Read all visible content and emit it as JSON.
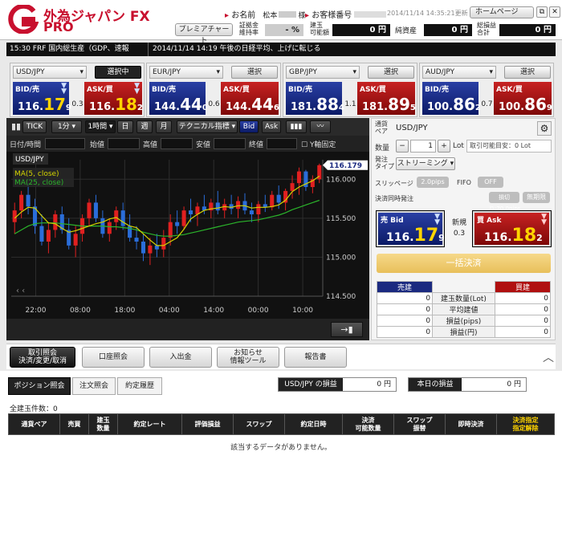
{
  "header": {
    "logo_main": "外為ジャパン",
    "logo_fx": "FX",
    "logo_sub": "PRO",
    "name_label": "お名前",
    "name_value": "松本",
    "name_suffix": "様",
    "customer_label": "お客様番号",
    "timestamp": "2014/11/14 14:35:21更新",
    "home_button": "ホームページ",
    "demo_button": "プレミアチャート",
    "margin_label": "証拠金\n維持率",
    "margin_value": "- %",
    "collateral_label": "建玉\n可能額",
    "collateral_value": "0 円",
    "net_asset_label": "純資産",
    "net_asset_value": "0 円",
    "total_pl_label": "総損益\n合計",
    "total_pl_value": "0 円"
  },
  "news": {
    "left": "15:30 FRF 国内総生産（GDP、速報",
    "right": "2014/11/14 14:19 午後の日経平均、上げに転じる"
  },
  "currency_panels": [
    {
      "pair": "USD/JPY",
      "button": "選択中",
      "bid_label": "BID/売",
      "ask_label": "ASK/買",
      "bid_prefix": "116.",
      "bid_big": "17",
      "bid_small": "9",
      "ask_prefix": "116.",
      "ask_big": "18",
      "ask_small": "2",
      "spread": "0.3"
    },
    {
      "pair": "EUR/JPY",
      "button": "選択",
      "bid_label": "BID/売",
      "ask_label": "ASK/買",
      "bid_prefix": "144.",
      "bid_big": "44",
      "bid_small": "0",
      "ask_prefix": "144.",
      "ask_big": "44",
      "ask_small": "6",
      "spread": "0.6"
    },
    {
      "pair": "GBP/JPY",
      "button": "選択",
      "bid_label": "BID/売",
      "ask_label": "ASK/買",
      "bid_prefix": "181.",
      "bid_big": "88",
      "bid_small": "4",
      "ask_prefix": "181.",
      "ask_big": "89",
      "ask_small": "5",
      "spread": "1.1"
    },
    {
      "pair": "AUD/JPY",
      "button": "選択",
      "bid_label": "BID/売",
      "ask_label": "ASK/買",
      "bid_prefix": "100.",
      "bid_big": "86",
      "bid_small": "2",
      "ask_prefix": "100.",
      "ask_big": "86",
      "ask_small": "9",
      "spread": "0.7"
    }
  ],
  "chart_toolbar": {
    "tick": "TICK",
    "period": "1分",
    "timeframe": "1時間",
    "day": "日",
    "week": "週",
    "month": "月",
    "technical": "テクニカル指標",
    "bid": "Bid",
    "ask": "Ask",
    "date_label": "日付/時間",
    "open_label": "始値",
    "high_label": "高値",
    "low_label": "安値",
    "close_label": "終値",
    "yfix_label": "Y軸固定"
  },
  "chart_data": {
    "type": "candlestick",
    "symbol": "USD/JPY",
    "legend": [
      "MA(5, close)",
      "MA(25, close)"
    ],
    "x_ticks": [
      "22:00",
      "08:00",
      "18:00",
      "04:00",
      "14:00",
      "00:00",
      "10:00"
    ],
    "y_ticks": [
      116.0,
      115.5,
      115.0,
      114.5
    ],
    "ylim": [
      114.5,
      116.25
    ],
    "current_price": "116.179",
    "ma_colors": {
      "ma5": "#d4d400",
      "ma25": "#2bb52b"
    },
    "up_color": "#e02020",
    "down_color": "#2a6dd9",
    "candles": [
      {
        "o": 115.45,
        "h": 115.7,
        "l": 115.3,
        "c": 115.6
      },
      {
        "o": 115.6,
        "h": 115.85,
        "l": 115.5,
        "c": 115.8
      },
      {
        "o": 115.8,
        "h": 115.95,
        "l": 115.55,
        "c": 115.65
      },
      {
        "o": 115.65,
        "h": 115.75,
        "l": 115.3,
        "c": 115.4
      },
      {
        "o": 115.4,
        "h": 115.55,
        "l": 115.15,
        "c": 115.2
      },
      {
        "o": 115.2,
        "h": 115.45,
        "l": 115.05,
        "c": 115.35
      },
      {
        "o": 115.35,
        "h": 115.6,
        "l": 115.25,
        "c": 115.55
      },
      {
        "o": 115.55,
        "h": 115.65,
        "l": 115.3,
        "c": 115.35
      },
      {
        "o": 115.35,
        "h": 115.5,
        "l": 115.1,
        "c": 115.15
      },
      {
        "o": 115.15,
        "h": 115.4,
        "l": 115.0,
        "c": 115.3
      },
      {
        "o": 115.3,
        "h": 115.55,
        "l": 115.2,
        "c": 115.5
      },
      {
        "o": 115.5,
        "h": 115.75,
        "l": 115.4,
        "c": 115.7
      },
      {
        "o": 115.7,
        "h": 115.8,
        "l": 115.45,
        "c": 115.5
      },
      {
        "o": 115.5,
        "h": 115.6,
        "l": 115.25,
        "c": 115.3
      },
      {
        "o": 115.3,
        "h": 115.5,
        "l": 115.2,
        "c": 115.45
      },
      {
        "o": 115.45,
        "h": 115.65,
        "l": 115.35,
        "c": 115.6
      },
      {
        "o": 115.6,
        "h": 115.7,
        "l": 115.35,
        "c": 115.4
      },
      {
        "o": 115.4,
        "h": 115.55,
        "l": 115.2,
        "c": 115.25
      },
      {
        "o": 115.25,
        "h": 115.4,
        "l": 115.1,
        "c": 115.2
      },
      {
        "o": 115.2,
        "h": 115.3,
        "l": 114.95,
        "c": 115.05
      },
      {
        "o": 115.05,
        "h": 115.25,
        "l": 114.9,
        "c": 115.15
      },
      {
        "o": 115.15,
        "h": 115.3,
        "l": 115.0,
        "c": 115.1
      },
      {
        "o": 115.1,
        "h": 115.35,
        "l": 115.0,
        "c": 115.25
      },
      {
        "o": 115.25,
        "h": 115.55,
        "l": 115.15,
        "c": 115.45
      },
      {
        "o": 115.45,
        "h": 115.6,
        "l": 115.3,
        "c": 115.4
      },
      {
        "o": 115.4,
        "h": 115.65,
        "l": 115.35,
        "c": 115.6
      },
      {
        "o": 115.6,
        "h": 115.75,
        "l": 115.45,
        "c": 115.55
      },
      {
        "o": 115.55,
        "h": 115.7,
        "l": 115.4,
        "c": 115.65
      },
      {
        "o": 115.65,
        "h": 115.8,
        "l": 115.55,
        "c": 115.6
      },
      {
        "o": 115.6,
        "h": 115.75,
        "l": 115.5,
        "c": 115.7
      },
      {
        "o": 115.7,
        "h": 115.85,
        "l": 115.55,
        "c": 115.6
      },
      {
        "o": 115.6,
        "h": 115.75,
        "l": 115.5,
        "c": 115.68
      },
      {
        "o": 115.68,
        "h": 115.8,
        "l": 115.55,
        "c": 115.62
      },
      {
        "o": 115.62,
        "h": 115.78,
        "l": 115.5,
        "c": 115.72
      },
      {
        "o": 115.72,
        "h": 115.82,
        "l": 115.55,
        "c": 115.6
      },
      {
        "o": 115.6,
        "h": 115.7,
        "l": 115.45,
        "c": 115.55
      },
      {
        "o": 115.55,
        "h": 115.72,
        "l": 115.45,
        "c": 115.68
      },
      {
        "o": 115.68,
        "h": 115.8,
        "l": 115.58,
        "c": 115.64
      },
      {
        "o": 115.64,
        "h": 115.85,
        "l": 115.6,
        "c": 115.8
      },
      {
        "o": 115.8,
        "h": 115.92,
        "l": 115.62,
        "c": 115.7
      },
      {
        "o": 115.7,
        "h": 115.88,
        "l": 115.6,
        "c": 115.85
      },
      {
        "o": 115.85,
        "h": 116.05,
        "l": 115.75,
        "c": 115.95
      },
      {
        "o": 115.95,
        "h": 116.15,
        "l": 115.8,
        "c": 116.1
      },
      {
        "o": 116.1,
        "h": 116.12,
        "l": 115.85,
        "c": 115.9
      },
      {
        "o": 115.9,
        "h": 116.05,
        "l": 115.82,
        "c": 116.0
      },
      {
        "o": 116.0,
        "h": 116.2,
        "l": 115.95,
        "c": 116.18
      }
    ],
    "ma5": [
      115.5,
      115.58,
      115.64,
      115.63,
      115.53,
      115.44,
      115.43,
      115.37,
      115.32,
      115.34,
      115.37,
      115.4,
      115.43,
      115.45,
      115.49,
      115.51,
      115.45,
      115.4,
      115.38,
      115.3,
      115.22,
      115.15,
      115.15,
      115.2,
      115.25,
      115.36,
      115.49,
      115.55,
      115.6,
      115.62,
      115.63,
      115.65,
      115.64,
      115.66,
      115.66,
      115.63,
      115.64,
      115.64,
      115.65,
      115.67,
      115.73,
      115.84,
      115.9,
      115.94,
      115.98,
      116.04
    ],
    "ma25": [
      115.3,
      115.35,
      115.4,
      115.43,
      115.44,
      115.44,
      115.44,
      115.43,
      115.42,
      115.41,
      115.4,
      115.4,
      115.4,
      115.4,
      115.39,
      115.39,
      115.38,
      115.37,
      115.35,
      115.32,
      115.3,
      115.28,
      115.27,
      115.27,
      115.28,
      115.29,
      115.31,
      115.33,
      115.35,
      115.37,
      115.39,
      115.41,
      115.43,
      115.45,
      115.46,
      115.47,
      115.48,
      115.5,
      115.52,
      115.54,
      115.57,
      115.61,
      115.64,
      115.67,
      115.7,
      115.73
    ]
  },
  "order_panel": {
    "pair_label": "通貨\nペア",
    "pair_value": "USD/JPY",
    "qty_label": "数量",
    "qty_value": "1",
    "lot_label": "Lot",
    "margin_hint": "取引可能目安：0 Lot",
    "order_type_label": "発注\nタイプ",
    "order_type_value": "ストリーミング",
    "slippage_label": "スリッページ",
    "slippage_value": "2.0pips",
    "fifo_label": "FIFO",
    "fifo_value": "OFF",
    "simul_label": "決済同時発注",
    "stop_value": "損切り:20.0pips",
    "unlimited_value": "無期限",
    "sell_label": "売 Bid",
    "sell_prefix": "116.",
    "sell_big": "17",
    "sell_small": "9",
    "new_label": "新規",
    "spread": "0.3",
    "buy_label": "買 Ask",
    "buy_prefix": "116.",
    "buy_big": "18",
    "buy_small": "2",
    "settle_button": "一括決済",
    "sell_pos_header": "売建",
    "buy_pos_header": "買建",
    "rows": [
      {
        "label": "建玉数量(Lot)",
        "sell": "0",
        "buy": "0"
      },
      {
        "label": "平均建値",
        "sell": "0",
        "buy": "0"
      },
      {
        "label": "損益(pips)",
        "sell": "0",
        "buy": "0"
      },
      {
        "label": "損益(円)",
        "sell": "0",
        "buy": "0"
      }
    ]
  },
  "nav": {
    "trade": "取引照会\n決済/変更/取消",
    "account": "口座照会",
    "deposit": "入出金",
    "news": "お知らせ\n情報ツール",
    "report": "報告書"
  },
  "lower": {
    "tab_positions": "ポジション照会",
    "tab_orders": "注文照会",
    "tab_history": "約定履歴",
    "usdjpy_pl_label": "USD/JPY の損益",
    "usdjpy_pl_value": "0 円",
    "today_pl_label": "本日の損益",
    "today_pl_value": "0 円",
    "count_line": "全建玉件数：0",
    "columns": [
      "通貨ペア",
      "売買",
      "建玉\n数量",
      "約定レート",
      "評価損益",
      "スワップ",
      "約定日時",
      "決済\n可能数量",
      "スワップ\n振替",
      "即時決済",
      "決済指定\n指定解除"
    ],
    "no_data": "該当するデータがありません。"
  }
}
